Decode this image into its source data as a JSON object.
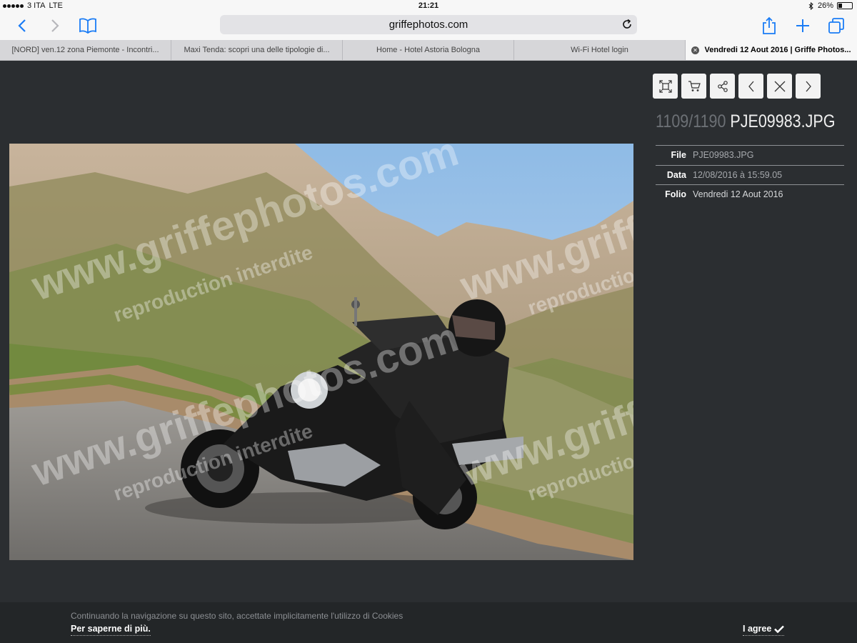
{
  "status_bar": {
    "carrier": "3 ITA",
    "network": "LTE",
    "time": "21:21",
    "battery": "26%",
    "battery_level": 0.26
  },
  "browser": {
    "url": "griffephotos.com",
    "icons": {
      "back": "chevron-left-icon",
      "forward": "chevron-right-icon",
      "bookmarks": "book-icon",
      "reload": "reload-icon",
      "share": "share-icon",
      "new_tab": "plus-icon",
      "tabs": "tabs-icon"
    },
    "accent_color": "#1a7cf5"
  },
  "tabs": [
    {
      "label": "[NORD] ven.12 zona Piemonte - Incontri..."
    },
    {
      "label": "Maxi Tenda: scopri una delle tipologie di..."
    },
    {
      "label": "Home - Hotel Astoria Bologna"
    },
    {
      "label": "Wi-Fi Hotel login"
    },
    {
      "label": "Vendredi 12 Aout 2016 | Griffe Photos...",
      "active": true
    }
  ],
  "viewer": {
    "counter": "1109/1190",
    "filename": "PJE09983.JPG",
    "actions": [
      "expand-icon",
      "cart-icon",
      "share-nodes-icon",
      "chevron-left-icon",
      "close-icon",
      "chevron-right-icon"
    ],
    "meta": [
      {
        "key": "File",
        "value": "PJE09983.JPG"
      },
      {
        "key": "Data",
        "value": "12/08/2016 à 15:59.05"
      },
      {
        "key": "Folio",
        "value": "Vendredi 12 Aout 2016"
      }
    ],
    "watermark": {
      "site": "www.griffephotos.com",
      "note": "reproduction interdite"
    }
  },
  "cookie": {
    "text": "Continuando la navigazione su questo sito, accettate implicitamente l'utilizzo di Cookies",
    "link": "Per saperne di più.",
    "agree": "I agree"
  }
}
